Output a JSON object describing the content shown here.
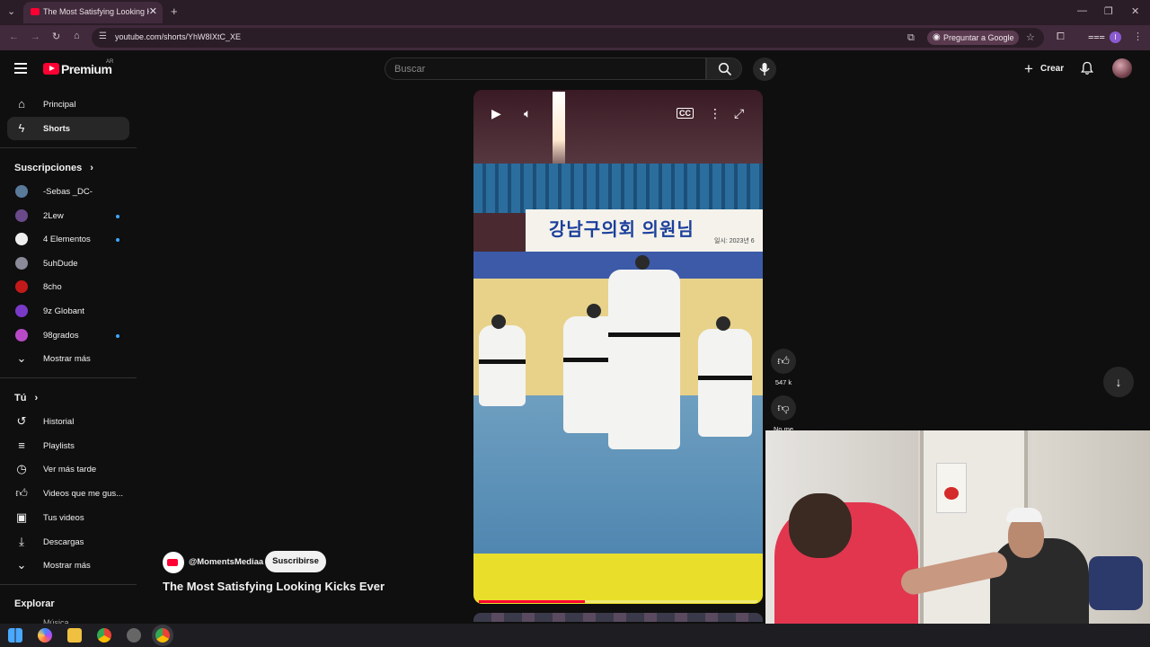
{
  "browser": {
    "tab_title": "The Most Satisfying Looking Ki",
    "url": "youtube.com/shorts/YhW8IXtC_XE",
    "google_button": "Preguntar a Google",
    "profile_initial": "I"
  },
  "header": {
    "logo_text": "Premium",
    "region": "AR",
    "search_placeholder": "Buscar",
    "create_label": "Crear"
  },
  "sidebar": {
    "main": [
      {
        "label": "Principal",
        "icon": "home-icon"
      },
      {
        "label": "Shorts",
        "icon": "shorts-icon",
        "active": true
      }
    ],
    "subscriptions_title": "Suscripciones",
    "subscriptions": [
      {
        "label": "-Sebas _DC-",
        "color": "#5a7a9a",
        "dot": false
      },
      {
        "label": "2Lew",
        "color": "#6a4a8a",
        "dot": true
      },
      {
        "label": "4 Elementos",
        "color": "#eeeeee",
        "dot": true
      },
      {
        "label": "5uhDude",
        "color": "#8a8a9a",
        "dot": false
      },
      {
        "label": "8cho",
        "color": "#c21a1a",
        "dot": false
      },
      {
        "label": "9z Globant",
        "color": "#7a3ac8",
        "dot": false
      },
      {
        "label": "98grados",
        "color": "#b84ac8",
        "dot": true
      }
    ],
    "show_more_1": "Mostrar más",
    "you_title": "Tú",
    "you": [
      {
        "label": "Historial",
        "icon": "history-icon"
      },
      {
        "label": "Playlists",
        "icon": "playlists-icon"
      },
      {
        "label": "Ver más tarde",
        "icon": "watch-later-icon"
      },
      {
        "label": "Videos que me gus...",
        "icon": "liked-videos-icon"
      },
      {
        "label": "Tus videos",
        "icon": "your-videos-icon"
      },
      {
        "label": "Descargas",
        "icon": "downloads-icon"
      }
    ],
    "show_more_2": "Mostrar más",
    "explore_title": "Explorar",
    "explore_first": "Música"
  },
  "video": {
    "banner_text": "강남구의회 의원님",
    "banner_date": "일시: 2023년 6",
    "progress": 0.38
  },
  "actions": {
    "likes": "547 k",
    "dislike_label": "No me"
  },
  "channel": {
    "name": "@MomentsMediaa",
    "subscribe_label": "Suscribirse",
    "video_title": "The Most Satisfying Looking Kicks Ever"
  }
}
